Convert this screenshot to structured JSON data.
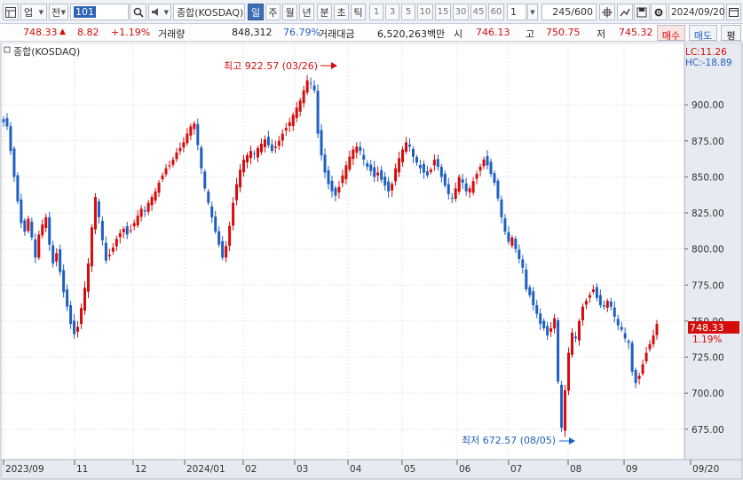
{
  "toolbar": {
    "market_label": "업",
    "period_label": "전",
    "code_value": "101",
    "index_name": "종합(KOSDAQ)",
    "period_tabs": [
      "일",
      "주",
      "월",
      "년",
      "분",
      "초",
      "틱"
    ],
    "active_period": "일",
    "interval_buttons": [
      "1",
      "3",
      "5",
      "10",
      "15",
      "30",
      "45",
      "60"
    ],
    "interval_select": "1",
    "count_display": "245",
    "count_total": "/600",
    "date_value": "2024/09/20"
  },
  "quote": {
    "price": "748.33",
    "change": "8.82",
    "change_pct": "+1.19%",
    "volume_label": "거래량",
    "volume": "848,312",
    "volume_ratio": "76.79%",
    "amount_label": "거래대금",
    "amount": "6,520,263백만",
    "open_label": "시",
    "open": "746.13",
    "high_label": "고",
    "high": "750.75",
    "low_label": "저",
    "low": "745.32",
    "buy_label": "매수",
    "sell_label": "매도",
    "avg_label": "평"
  },
  "chart_data": {
    "type": "candlestick",
    "title": "종합(KOSDAQ)",
    "lc_label": "LC:11.26",
    "hc_label": "HC:-18.89",
    "ylim": [
      657,
      937
    ],
    "yticks": [
      "900.00",
      "875.00",
      "850.00",
      "825.00",
      "800.00",
      "775.00",
      "750.00",
      "725.00",
      "700.00",
      "675.00"
    ],
    "xticks": [
      "2023/09",
      "11",
      "12",
      "2024/01",
      "02",
      "03",
      "04",
      "05",
      "06",
      "07",
      "08",
      "09",
      "09/20"
    ],
    "high_annotation": "최고 922.57 (03/26)",
    "low_annotation": "최저 672.57 (08/05)",
    "last_price": "748.33",
    "last_change_pct": "1.19%",
    "colors": {
      "up": "#d40c0c",
      "down": "#1f5fc1",
      "grid": "#e3e6ec",
      "axis_bg": "#e5e8ef"
    },
    "close": [
      888,
      885,
      868,
      850,
      833,
      818,
      812,
      821,
      808,
      794,
      810,
      817,
      822,
      803,
      790,
      797,
      784,
      770,
      760,
      748,
      741,
      746,
      759,
      773,
      790,
      815,
      836,
      822,
      806,
      792,
      796,
      801,
      807,
      811,
      814,
      810,
      813,
      818,
      823,
      828,
      826,
      832,
      836,
      840,
      846,
      851,
      856,
      858,
      862,
      867,
      870,
      874,
      880,
      885,
      887,
      872,
      856,
      842,
      832,
      822,
      812,
      803,
      794,
      802,
      816,
      832,
      845,
      855,
      862,
      865,
      868,
      866,
      870,
      873,
      876,
      872,
      868,
      871,
      875,
      880,
      884,
      888,
      893,
      898,
      903,
      910,
      917,
      915,
      910,
      880,
      865,
      853,
      845,
      840,
      837,
      843,
      851,
      858,
      864,
      869,
      871,
      868,
      862,
      857,
      854,
      850,
      853,
      848,
      844,
      840,
      845,
      856,
      863,
      869,
      874,
      871,
      864,
      860,
      856,
      853,
      851,
      855,
      862,
      857,
      850,
      844,
      838,
      835,
      842,
      850,
      846,
      840,
      842,
      847,
      852,
      857,
      862,
      858,
      852,
      846,
      835,
      822,
      812,
      805,
      808,
      800,
      793,
      787,
      772,
      768,
      761,
      755,
      748,
      745,
      740,
      745,
      752,
      708,
      676,
      702,
      728,
      742,
      738,
      750,
      760,
      764,
      768,
      772,
      766,
      761,
      760,
      764,
      760,
      753,
      747,
      744,
      738,
      735,
      715,
      707,
      712,
      720,
      728,
      734,
      740,
      748
    ]
  }
}
